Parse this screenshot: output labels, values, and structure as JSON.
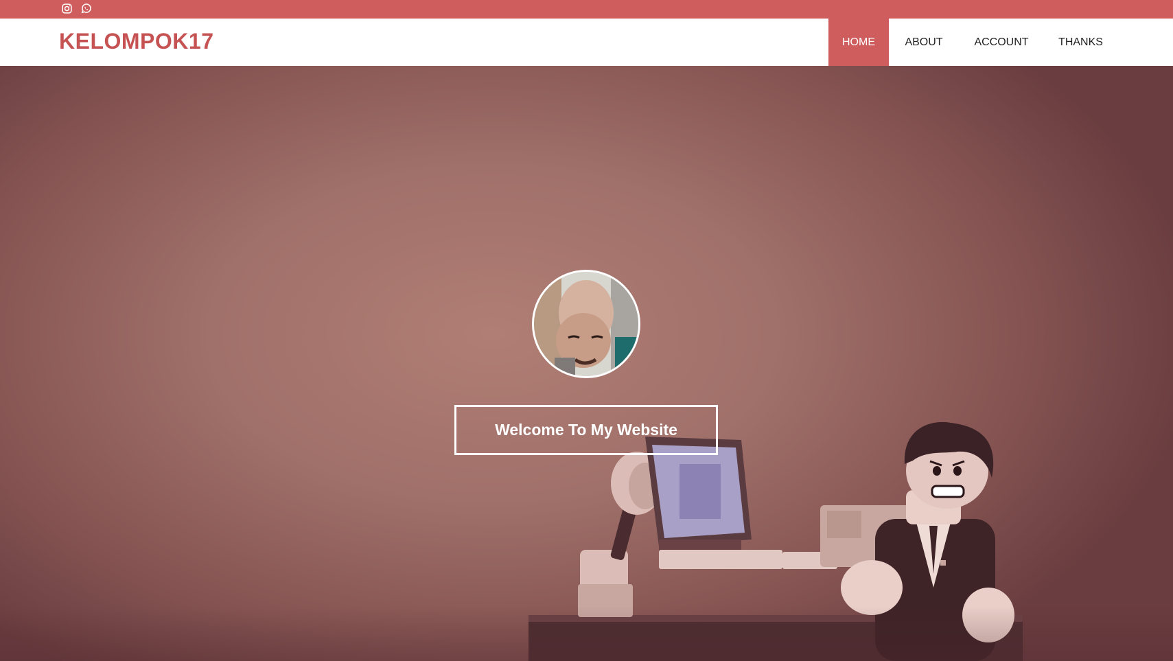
{
  "topbar": {
    "icons": [
      "instagram-icon",
      "whatsapp-icon"
    ],
    "color": "#d05d5d"
  },
  "navbar": {
    "brand": "KELOMPOK17",
    "brand_color": "#c65353",
    "items": [
      {
        "label": "HOME",
        "active": true
      },
      {
        "label": "ABOUT",
        "active": false
      },
      {
        "label": "ACCOUNT",
        "active": false
      },
      {
        "label": "THANKS",
        "active": false
      }
    ]
  },
  "hero": {
    "welcome_label": "Welcome To My Website"
  }
}
